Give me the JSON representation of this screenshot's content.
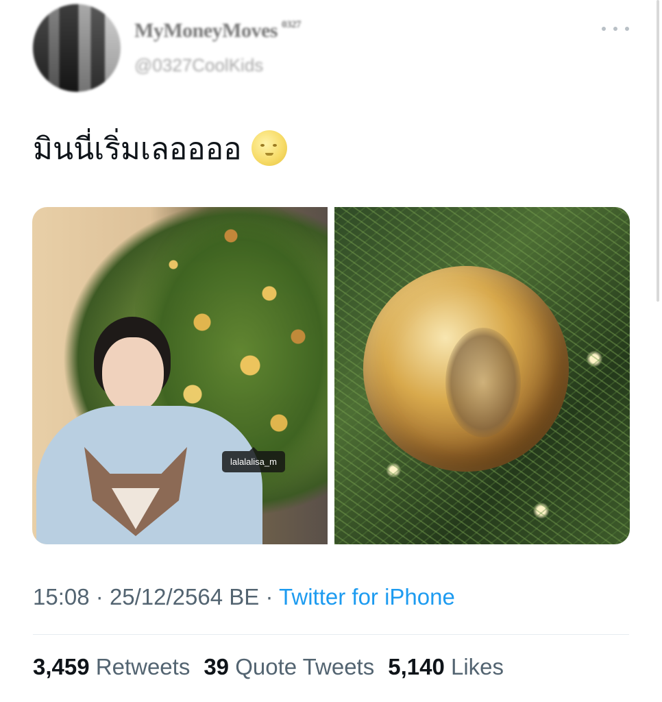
{
  "author": {
    "display_name": "MyMoneyMoves",
    "badge": "0327",
    "handle": "@0327CoolKids"
  },
  "tweet": {
    "text": "มินนี่เริ่มเลออออ",
    "emoji": "full-moon-face"
  },
  "media": {
    "left_tag": "lalalalisa_m"
  },
  "meta": {
    "time": "15:08",
    "sep": "·",
    "date": "25/12/2564 BE",
    "source": "Twitter for iPhone"
  },
  "stats": {
    "retweets_count": "3,459",
    "retweets_label": "Retweets",
    "quotes_count": "39",
    "quotes_label": "Quote Tweets",
    "likes_count": "5,140",
    "likes_label": "Likes"
  },
  "icons": {
    "more": "more-horizontal-icon"
  },
  "colors": {
    "link": "#1d9bf0",
    "secondary_text": "#536471",
    "primary_text": "#0f1419"
  }
}
